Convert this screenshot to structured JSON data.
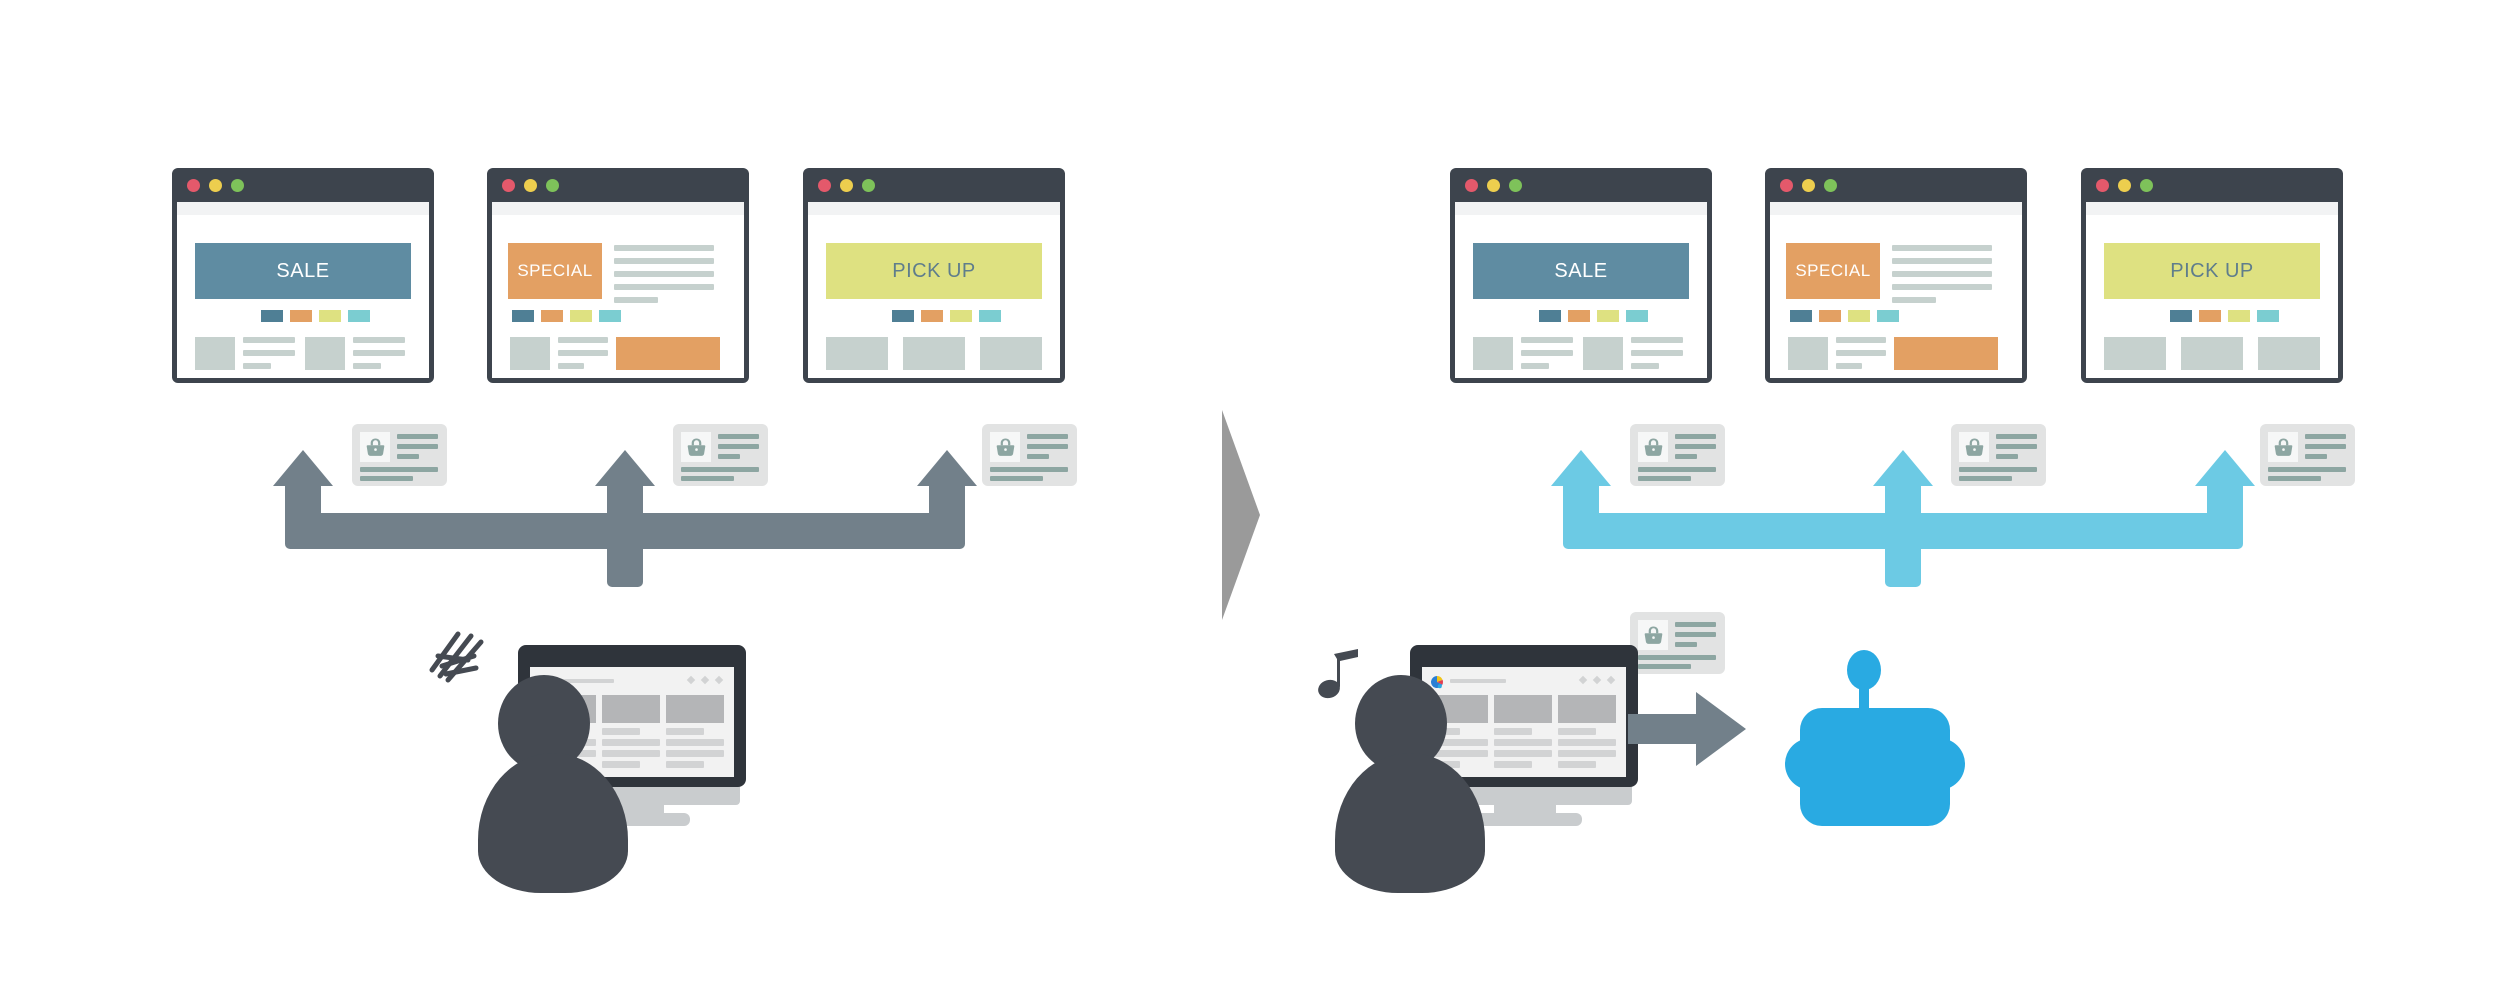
{
  "figure": {
    "type": "comparison-diagram",
    "title": "Manual multi-site login versus automated bot login",
    "divider_icon": "right-triangle-divider"
  },
  "palette": {
    "window_frame": "#3d444d",
    "dot_red": "#e4596b",
    "dot_yellow": "#edce4e",
    "dot_green": "#7ec25a",
    "hero_sale": "#5f8ca2",
    "hero_special": "#e3a063",
    "hero_pickup": "#dee181",
    "hero_pickup_text": "#5f7d8c",
    "swatch_blue": "#4f7f95",
    "swatch_orange": "#e3a063",
    "swatch_yellow": "#dee181",
    "swatch_teal": "#7bcdd1",
    "placeholder": "#c6d1ce",
    "arrow_gray": "#72808a",
    "arrow_blue": "#6ccae4",
    "card_bg": "#e2e3e3",
    "card_line": "#8da6a2",
    "person": "#454a52",
    "monitor_bezel": "#2f343b",
    "monitor_stand": "#c9ccce",
    "robot": "#29aae2",
    "divider_gray": "#9a9a9a",
    "background": "#ffffff"
  },
  "left_panel": {
    "label": "manual-login-panel",
    "mood_icon": "scribble-frustration-icon",
    "arrow_color": "#72808a",
    "windows": [
      {
        "name": "browser-window-sale",
        "hero_label": "SALE",
        "hero_color": "#5f8ca2",
        "hero_text_color": "#ffffff",
        "layout": "banner-wide",
        "dots": [
          "#e4596b",
          "#edce4e",
          "#7ec25a"
        ],
        "swatches": [
          "#4f7f95",
          "#e3a063",
          "#dee181",
          "#7bcdd1"
        ]
      },
      {
        "name": "browser-window-special",
        "hero_label": "SPECIAL",
        "hero_color": "#e3a063",
        "hero_text_color": "#ffffff",
        "layout": "banner-left-with-text",
        "dots": [
          "#e4596b",
          "#edce4e",
          "#7ec25a"
        ],
        "swatches": [
          "#4f7f95",
          "#e3a063",
          "#dee181",
          "#7bcdd1"
        ]
      },
      {
        "name": "browser-window-pickup",
        "hero_label": "PICK UP",
        "hero_color": "#dee181",
        "hero_text_color": "#5f7d8c",
        "layout": "banner-wide-three-tiles",
        "dots": [
          "#e4596b",
          "#edce4e",
          "#7ec25a"
        ],
        "swatches": [
          "#4f7f95",
          "#e3a063",
          "#dee181",
          "#7bcdd1"
        ]
      }
    ],
    "credentials": [
      {
        "name": "credential-card-1",
        "icon": "handbag-icon"
      },
      {
        "name": "credential-card-2",
        "icon": "handbag-icon"
      },
      {
        "name": "credential-card-3",
        "icon": "handbag-icon"
      }
    ],
    "actor": {
      "name": "human-user-manual",
      "monitor_icon": "desktop-monitor-icon",
      "screen_brand_icon": "colorful-logo-icon",
      "screen_menu_icon": "three-dots-menu-icon"
    }
  },
  "right_panel": {
    "label": "automated-login-panel",
    "mood_icon": "music-note-happy-icon",
    "arrow_color": "#6ccae4",
    "windows": [
      {
        "name": "browser-window-sale",
        "hero_label": "SALE",
        "hero_color": "#5f8ca2",
        "hero_text_color": "#ffffff",
        "layout": "banner-wide",
        "dots": [
          "#e4596b",
          "#edce4e",
          "#7ec25a"
        ],
        "swatches": [
          "#4f7f95",
          "#e3a063",
          "#dee181",
          "#7bcdd1"
        ]
      },
      {
        "name": "browser-window-special",
        "hero_label": "SPECIAL",
        "hero_color": "#e3a063",
        "hero_text_color": "#ffffff",
        "layout": "banner-left-with-text",
        "dots": [
          "#e4596b",
          "#edce4e",
          "#7ec25a"
        ],
        "swatches": [
          "#4f7f95",
          "#e3a063",
          "#dee181",
          "#7bcdd1"
        ]
      },
      {
        "name": "browser-window-pickup",
        "hero_label": "PICK UP",
        "hero_color": "#dee181",
        "hero_text_color": "#5f7d8c",
        "layout": "banner-wide-three-tiles",
        "dots": [
          "#e4596b",
          "#edce4e",
          "#7ec25a"
        ],
        "swatches": [
          "#4f7f95",
          "#e3a063",
          "#dee181",
          "#7bcdd1"
        ]
      }
    ],
    "credentials": [
      {
        "name": "credential-card-1",
        "icon": "handbag-icon"
      },
      {
        "name": "credential-card-2",
        "icon": "handbag-icon"
      },
      {
        "name": "credential-card-3",
        "icon": "handbag-icon"
      },
      {
        "name": "credential-card-handoff",
        "icon": "handbag-icon"
      }
    ],
    "actor": {
      "name": "human-user-automated",
      "monitor_icon": "desktop-monitor-icon",
      "screen_brand_icon": "colorful-logo-icon",
      "screen_menu_icon": "three-dots-menu-icon"
    },
    "handoff_arrow_icon": "right-arrow-icon",
    "bot": {
      "name": "automation-bot",
      "icon": "robot-icon",
      "color": "#29aae2"
    }
  }
}
